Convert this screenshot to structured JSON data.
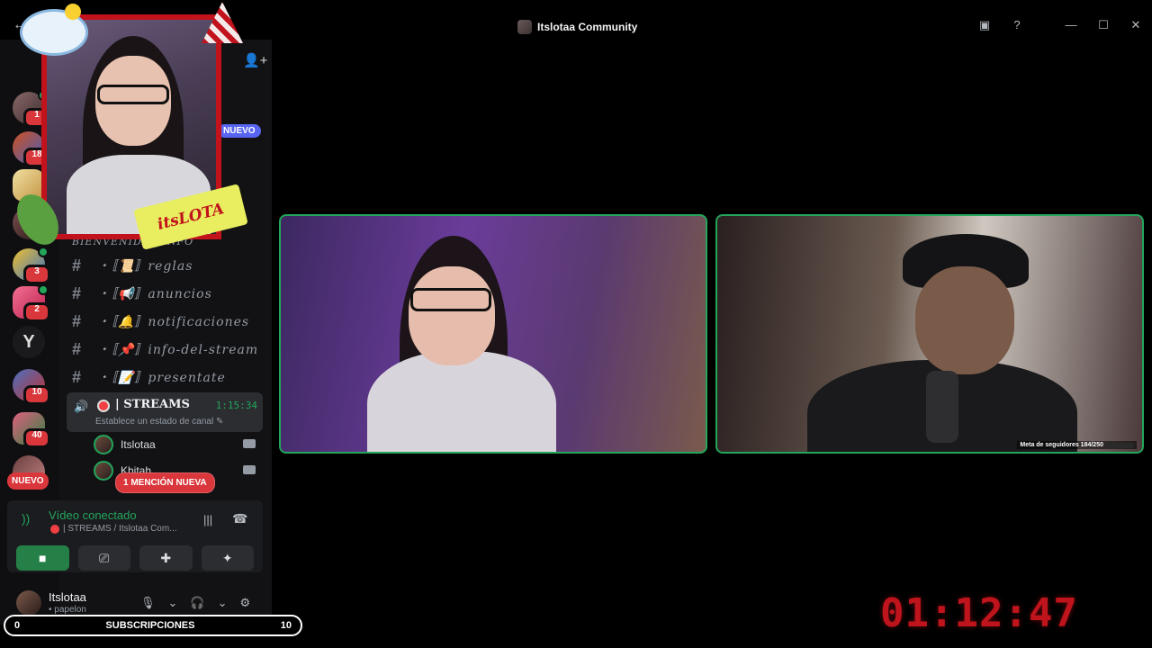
{
  "window": {
    "title": "Itslotaa Community"
  },
  "servers": [
    {
      "badge": "1"
    },
    {
      "badge": "18"
    },
    {
      "badge": ""
    },
    {
      "badge": ""
    },
    {
      "badge": "3"
    },
    {
      "badge": "2"
    },
    {
      "badge": ""
    },
    {
      "badge": "10"
    },
    {
      "badge": "40"
    }
  ],
  "sidebar": {
    "new_pill": "NUEVO",
    "category": "BIENVENIDA | INFO",
    "channels": [
      {
        "name": "・〚📜〛reglas"
      },
      {
        "name": "・〚📢〛anuncios"
      },
      {
        "name": "・〚🔔〛notificaciones"
      },
      {
        "name": "・〚📌〛info-del-stream"
      },
      {
        "name": "・〚📝〛presentate"
      }
    ],
    "voice_channel": {
      "name": "| STREAMS",
      "time": "1:15:34",
      "status": "Establece un estado de canal ✎"
    },
    "members": [
      {
        "name": "Itslotaa"
      },
      {
        "name": "Khitah"
      }
    ],
    "mention_pill": "1 MENCIÓN NUEVA",
    "new_left": "NUEVO"
  },
  "voice_panel": {
    "title": "Vídeo conectado",
    "subtitle": "| STREAMS / Itslotaa Com..."
  },
  "user": {
    "name": "Itslotaa",
    "status": "• papelon"
  },
  "overlay": {
    "logo_text": "itsLOTA",
    "subs_left": "0",
    "subs_label": "SUBSCRIPCIONES",
    "subs_right": "10",
    "timer": "01:12:47",
    "follower_goal": "Meta de seguidores 184/250",
    "follower_progress": 0.736
  },
  "colors": {
    "accent_green": "#23a55a",
    "badge_red": "#da373c",
    "blurple": "#5865f2",
    "timer_red": "#c0141c"
  }
}
